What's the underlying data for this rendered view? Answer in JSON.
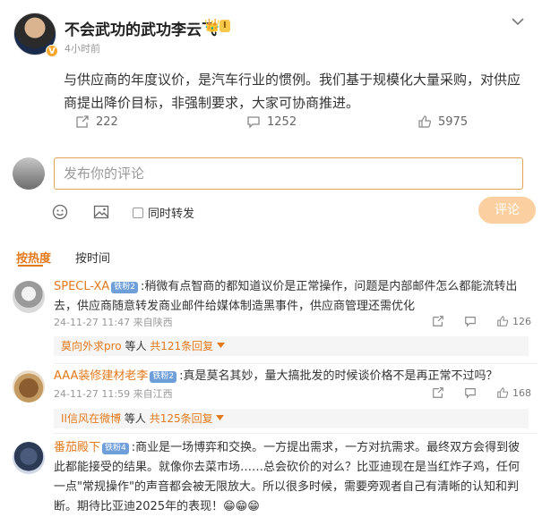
{
  "post": {
    "author": "不会武功的武功李云飞",
    "verified_mark": "V",
    "crown_icon": "👑",
    "level_badge": "I",
    "time": "4小时前",
    "text": "与供应商的年度议价，是汽车行业的惯例。我们基于规模化大量采购，对供应商提出降价目标，非强制要求，大家可协商推进。",
    "reposts": "222",
    "comments": "1252",
    "likes": "5975"
  },
  "comment_box": {
    "placeholder": "发布你的评论",
    "repost_label": "同时转发",
    "submit_label": "评论"
  },
  "sort_tabs": {
    "hot": "按热度",
    "time": "按时间"
  },
  "comments": [
    {
      "name": "SPECL-XA",
      "badge": "铁粉2",
      "text": ":稍微有点智商的都知道议价是正常操作，问题是内部邮件怎么都能流转出去，供应商随意转发商业邮件给媒体制造黑事件，供应商管理还需优化",
      "meta": "24-11-27 11:47 来自陕西",
      "likes": "126",
      "reply_who": "莫向外求pro",
      "reply_mid": " 等人 ",
      "reply_count": "共121条回复"
    },
    {
      "name": "AAA装修建材老李",
      "badge": "铁粉2",
      "text": ":真是莫名其妙，量大搞批发的时候谈价格不是再正常不过吗？",
      "meta": "24-11-27 11:59 来自江西",
      "likes": "168",
      "reply_who": "II信风在微博",
      "reply_mid": " 等人 ",
      "reply_count": "共125条回复"
    },
    {
      "name": "番茄殿下",
      "badge": "铁粉4",
      "text": ":商业是一场博弈和交换。一方提出需求，一方对抗需求。最终双方会得到彼此都能接受的结果。就像你去菜市场……总会砍价的对么？比亚迪现在是当红炸子鸡，任何一点\"常规操作\"的声音都会被无限放大。所以很多时候，需要旁观者自己有清晰的认知和判断。期待比亚迪2025年的表现！😁😁😁"
    }
  ],
  "colors": {
    "accent": "#e27a1c",
    "input_border": "#e0a35a",
    "submit_bg": "#fbcf9f",
    "badge_bg": "#6f9fd8"
  }
}
